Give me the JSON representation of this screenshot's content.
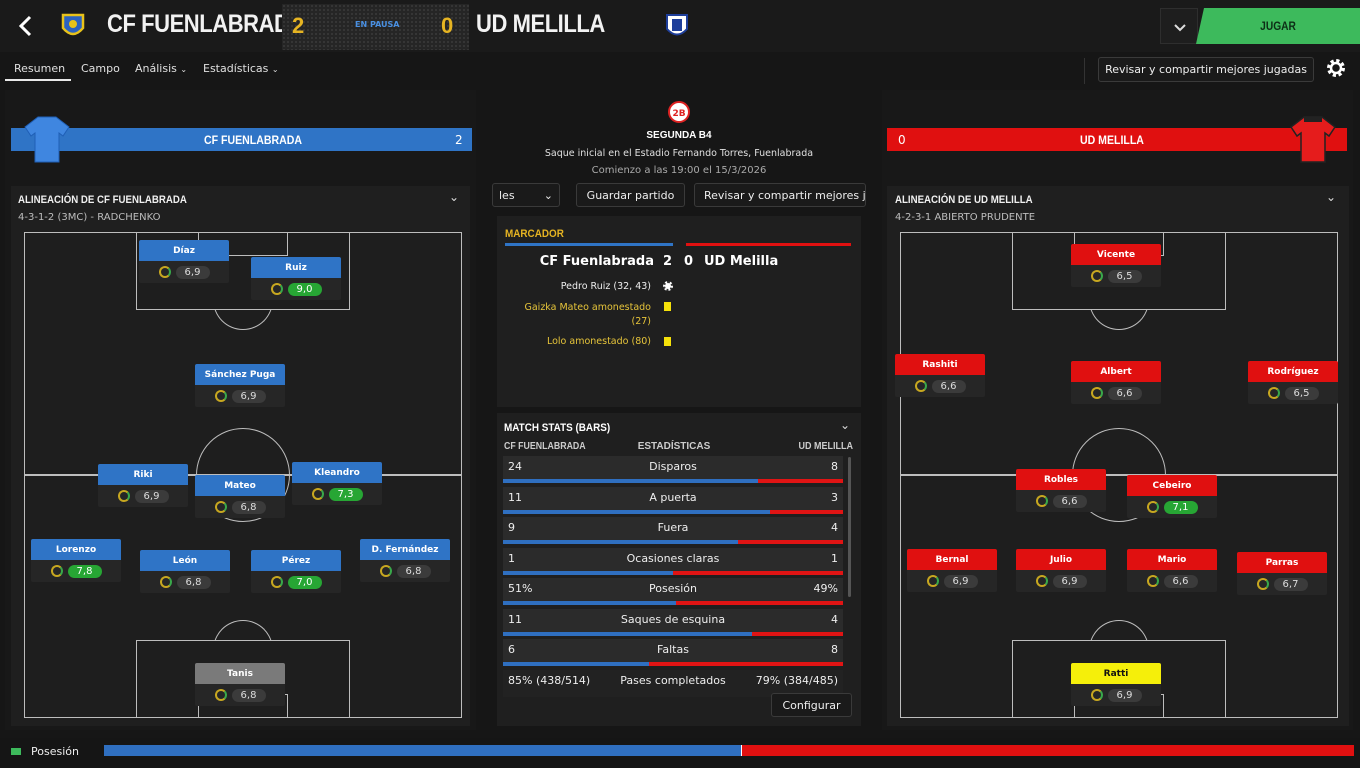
{
  "header": {
    "home_team": "CF FUENLABRADA",
    "away_team": "UD MELILLA",
    "home_score": "2",
    "away_score": "0",
    "status": "EN PAUSA",
    "play_button": "JUGAR"
  },
  "nav": {
    "tabs": [
      "Resumen",
      "Campo",
      "Análisis",
      "Estadísticas"
    ],
    "review_button": "Revisar y compartir mejores jugadas"
  },
  "home_banner": {
    "name": "CF FUENLABRADA",
    "score": "2"
  },
  "away_banner": {
    "name": "UD MELILLA",
    "score": "0"
  },
  "home_lineup": {
    "title": "ALINEACIÓN DE CF FUENLABRADA",
    "formation": "4-3-1-2 (3MC) - RADCHENKO",
    "players": [
      {
        "name": "Díaz",
        "rating": "6,9",
        "good": false
      },
      {
        "name": "Ruiz",
        "rating": "9,0",
        "good": true
      },
      {
        "name": "Sánchez Puga",
        "rating": "6,9",
        "good": false
      },
      {
        "name": "Riki",
        "rating": "6,9",
        "good": false
      },
      {
        "name": "Mateo",
        "rating": "6,8",
        "good": false
      },
      {
        "name": "Kleandro",
        "rating": "7,3",
        "good": true
      },
      {
        "name": "Lorenzo",
        "rating": "7,8",
        "good": true
      },
      {
        "name": "León",
        "rating": "6,8",
        "good": false
      },
      {
        "name": "Pérez",
        "rating": "7,0",
        "good": true
      },
      {
        "name": "D. Fernández",
        "rating": "6,8",
        "good": false
      },
      {
        "name": "Tanis",
        "rating": "6,8",
        "good": false
      }
    ]
  },
  "away_lineup": {
    "title": "ALINEACIÓN DE UD MELILLA",
    "formation": "4-2-3-1 ABIERTO PRUDENTE",
    "players": [
      {
        "name": "Vicente",
        "rating": "6,5",
        "good": false
      },
      {
        "name": "Rashiti",
        "rating": "6,6",
        "good": false
      },
      {
        "name": "Albert",
        "rating": "6,6",
        "good": false
      },
      {
        "name": "Rodríguez",
        "rating": "6,5",
        "good": false
      },
      {
        "name": "Robles",
        "rating": "6,6",
        "good": false
      },
      {
        "name": "Cebeiro",
        "rating": "7,1",
        "good": true
      },
      {
        "name": "Bernal",
        "rating": "6,9",
        "good": false
      },
      {
        "name": "Julio",
        "rating": "6,9",
        "good": false
      },
      {
        "name": "Mario",
        "rating": "6,6",
        "good": false
      },
      {
        "name": "Parras",
        "rating": "6,7",
        "good": false
      },
      {
        "name": "Ratti",
        "rating": "6,9",
        "good": false
      }
    ]
  },
  "match_info": {
    "competition": "SEGUNDA B4",
    "badge": "2B",
    "venue": "Saque inicial en el Estadio Fernando Torres, Fuenlabrada",
    "kickoff": "Comienzo a las 19:00 el 15/3/2026"
  },
  "toolbar": {
    "dropdown_value": "les",
    "save": "Guardar partido",
    "review": "Revisar y compartir mejores ju"
  },
  "scoreboard": {
    "title": "MARCADOR",
    "home": "CF Fuenlabrada",
    "home_goals": "2",
    "away_goals": "0",
    "away": "UD Melilla",
    "events": [
      {
        "text": "Pedro Ruiz (32, 43)",
        "type": "goal"
      },
      {
        "text": "Gaizka Mateo amonestado (27)",
        "type": "yellow"
      },
      {
        "text": "Lolo amonestado (80)",
        "type": "yellow"
      }
    ]
  },
  "stats": {
    "title": "MATCH STATS (BARS)",
    "col_home": "CF FUENLABRADA",
    "col_mid": "ESTADÍSTICAS",
    "col_away": "UD MELILLA",
    "configure": "Configurar",
    "rows": [
      {
        "label": "Disparos",
        "home": "24",
        "away": "8",
        "home_share": 0.75
      },
      {
        "label": "A puerta",
        "home": "11",
        "away": "3",
        "home_share": 0.786
      },
      {
        "label": "Fuera",
        "home": "9",
        "away": "4",
        "home_share": 0.692
      },
      {
        "label": "Ocasiones claras",
        "home": "1",
        "away": "1",
        "home_share": 0.5
      },
      {
        "label": "Posesión",
        "home": "51%",
        "away": "49%",
        "home_share": 0.51
      },
      {
        "label": "Saques de esquina",
        "home": "11",
        "away": "4",
        "home_share": 0.733
      },
      {
        "label": "Faltas",
        "home": "6",
        "away": "8",
        "home_share": 0.429
      },
      {
        "label": "Pases completados",
        "home": "85% (438/514)",
        "away": "79% (384/485)",
        "home_share": 0.5
      }
    ]
  },
  "footer": {
    "label": "Posesión",
    "home_share": 0.51
  },
  "colors": {
    "home": "#2f74c6",
    "away": "#e01010",
    "accent": "#e6b422",
    "play": "#3dba5c"
  }
}
